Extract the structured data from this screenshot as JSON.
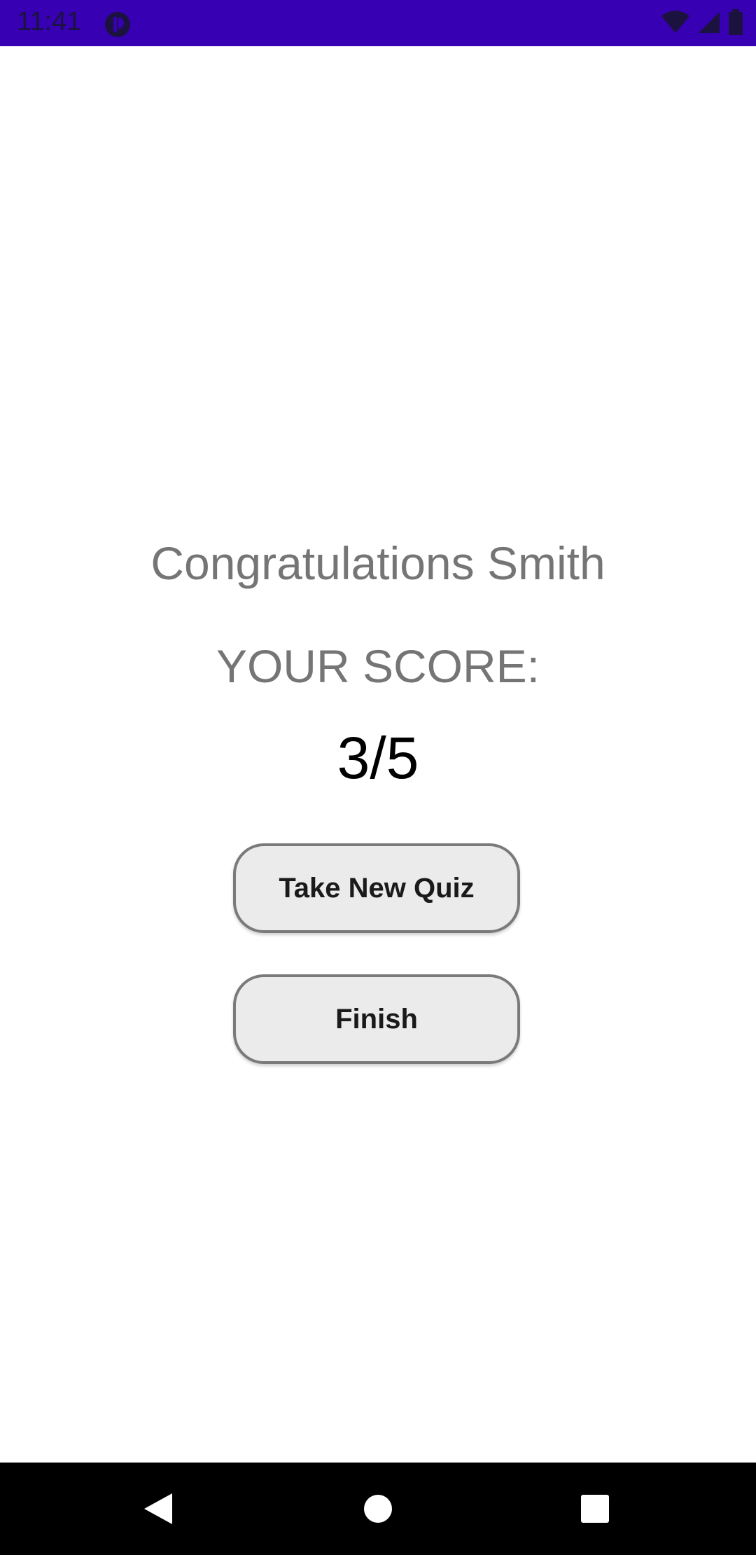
{
  "status_bar": {
    "time": "11:41",
    "background_color": "#3700B3",
    "icons": [
      "app-notification-icon",
      "wifi-icon",
      "signal-icon",
      "battery-icon"
    ]
  },
  "result": {
    "greeting": "Congratulations Smith",
    "score_label": "YOUR SCORE:",
    "score_value": "3/5"
  },
  "buttons": {
    "take_new_quiz": "Take New Quiz",
    "finish": "Finish"
  },
  "nav_bar": {
    "icons": [
      "back-icon",
      "home-icon",
      "recents-icon"
    ]
  }
}
